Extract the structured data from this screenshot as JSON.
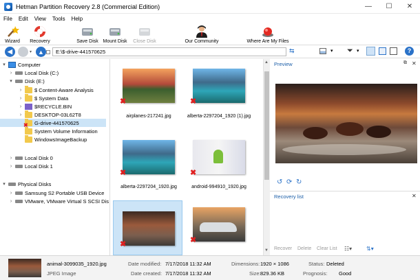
{
  "window": {
    "title": "Hetman Partition Recovery 2.8 (Commercial Edition)",
    "minimize": "—",
    "maximize": "☐",
    "close": "✕"
  },
  "menu": [
    "File",
    "Edit",
    "View",
    "Tools",
    "Help"
  ],
  "toolbar": {
    "wizard": "Wizard",
    "recovery": "Recovery",
    "save_disk": "Save Disk",
    "mount_disk": "Mount Disk",
    "close_disk": "Close Disk",
    "our_community": "Our Community",
    "where_files": "Where Are My Files"
  },
  "address": {
    "path": "E:\\$-drive-441570625"
  },
  "tree": [
    {
      "label": "Computer"
    },
    {
      "label": "Local Disk (C:)"
    },
    {
      "label": "Disk (E:)"
    },
    {
      "label": "$ Content-Aware Analysis"
    },
    {
      "label": "$ System Data"
    },
    {
      "label": "$RECYCLE.BIN"
    },
    {
      "label": "DESKTOP-03L62T8"
    },
    {
      "label": "G-drive-441570625"
    },
    {
      "label": "System Volume Information"
    },
    {
      "label": "WindowsImageBackup"
    },
    {
      "label": "Local Disk 0"
    },
    {
      "label": "Local Disk 1"
    },
    {
      "label": "Physical Disks"
    },
    {
      "label": "Samsung S2 Portable USB Device"
    },
    {
      "label": "VMware, VMware Virtual S SCSI Dis"
    }
  ],
  "files": [
    {
      "name": "airplanes-217241.jpg"
    },
    {
      "name": "alberta-2297204_1920 (1).jpg"
    },
    {
      "name": "alberta-2297204_1920.jpg"
    },
    {
      "name": "android-994910_1920.jpg"
    },
    {
      "name": "animal-3099035_1920.jpg"
    },
    {
      "name": "auto-3069394_1920.jpg"
    }
  ],
  "preview": {
    "title": "Preview"
  },
  "recovery_list": {
    "title": "Recovery list",
    "recover": "Recover",
    "delete": "Delete",
    "clear": "Clear List"
  },
  "status": {
    "filename": "animal-3099035_1920.jpg",
    "filetype": "JPEG Image",
    "modified_label": "Date modified:",
    "modified": "7/17/2018 11:32 AM",
    "created_label": "Date created:",
    "created": "7/17/2018 11:32 AM",
    "dimensions_label": "Dimensions:",
    "dimensions": "1920 × 1086",
    "size_label": "Size:",
    "size": "829.36 KB",
    "status_label": "Status:",
    "status": "Deleted",
    "prognosis_label": "Prognosis:",
    "prognosis": "Good"
  }
}
